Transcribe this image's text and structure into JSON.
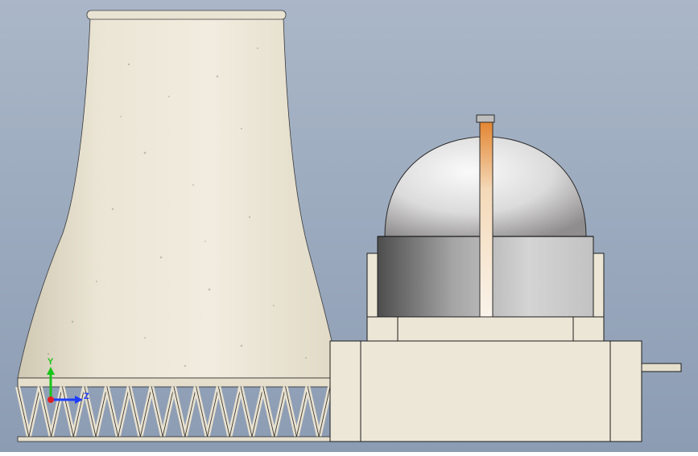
{
  "viewport": {
    "background_top": "#aab7c8",
    "background_bottom": "#8c9cb3"
  },
  "colors": {
    "concrete": "#ede7d8",
    "concrete_shadow": "#cdc5ad",
    "edge": "#1c1c1c",
    "dome_light": "#f7f6f6",
    "dome_dark": "#8f8d8d",
    "drum_dark": "#555555",
    "drum_light": "#dddddd",
    "stack_glow": "#e3842f"
  },
  "triad": {
    "y_label": "Y",
    "z_label": "Z",
    "y_color": "#19c419",
    "z_color": "#1f3dff",
    "x_color": "#e0201f"
  },
  "scene": {
    "objects": [
      "cooling-tower",
      "reactor-containment-dome",
      "reactor-base-building"
    ]
  }
}
